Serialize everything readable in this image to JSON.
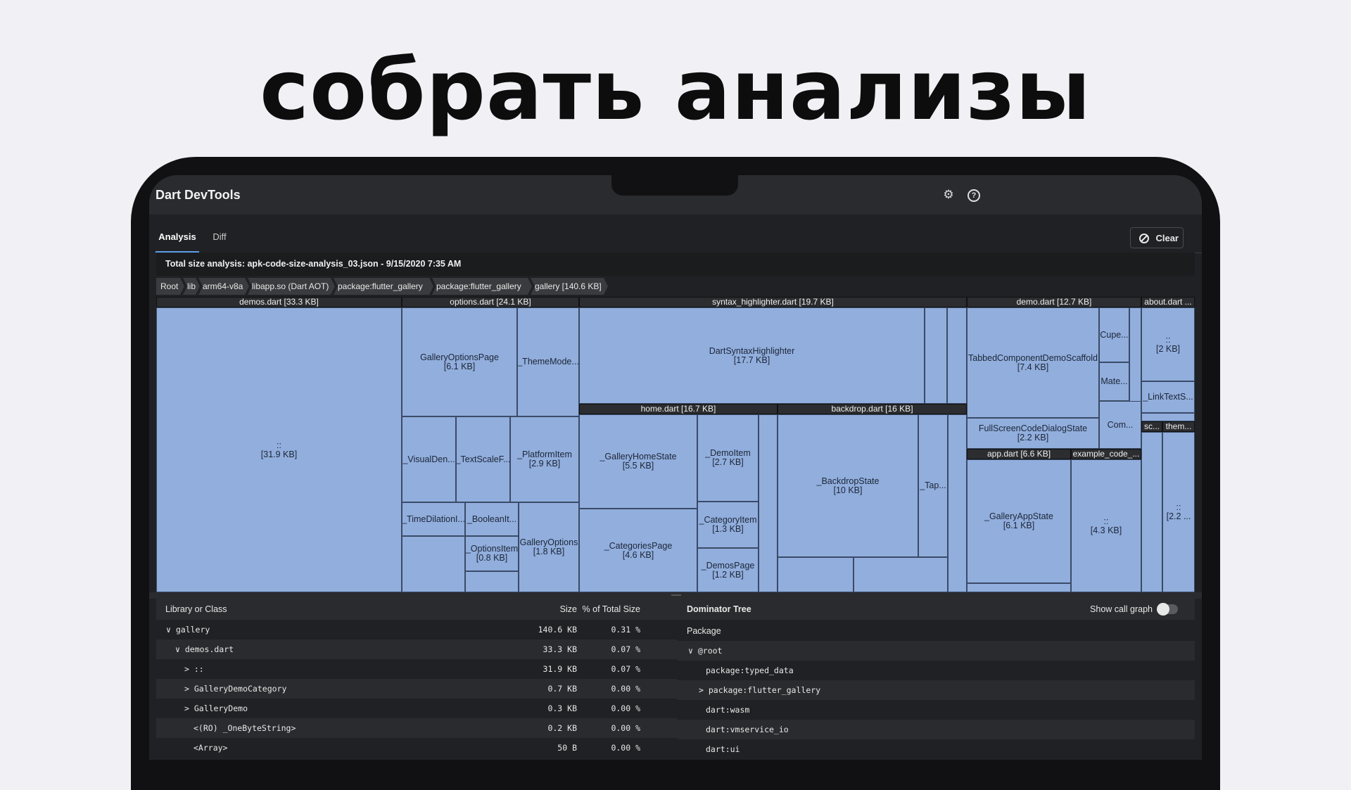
{
  "headline": "собрать анализы",
  "app": {
    "title": "Dart DevTools",
    "icons": [
      "settings-gear-icon",
      "help-circle-icon"
    ]
  },
  "tabs": [
    {
      "label": "Analysis",
      "active": true
    },
    {
      "label": "Diff",
      "active": false
    }
  ],
  "clear_label": "Clear",
  "summary": "Total size analysis: apk-code-size-analysis_03.json - 9/15/2020 7:35 AM",
  "breadcrumbs": [
    "Root",
    "lib",
    "arm64-v8a",
    "libapp.so (Dart AOT)",
    "package:flutter_gallery",
    "package:flutter_gallery",
    "gallery [140.6 KB]"
  ],
  "treemap": {
    "colors": {
      "cell": "#91aedd",
      "header": "#2c2d30"
    },
    "groups": {
      "demos": "demos.dart [33.3 KB]",
      "options": "options.dart [24.1 KB]",
      "syntax": "syntax_highlighter.dart [19.7 KB]",
      "demo": "demo.dart [12.7 KB]",
      "about": "about.dart ...",
      "home": "home.dart [16.7 KB]",
      "backdrop": "backdrop.dart [16 KB]",
      "app": "app.dart [6.6 KB]",
      "example": "example_code_...",
      "sc": "sc...",
      "them": "them..."
    },
    "cells": {
      "demos_root": "::\n[31.9 KB]",
      "gallery_options_page": "GalleryOptionsPage\n[6.1 KB]",
      "theme_mode": "_ThemeMode...",
      "visual_den": "_VisualDen...",
      "text_scale": "_TextScaleF...",
      "platform_item": "_PlatformItem\n[2.9 KB]",
      "time_dilation": "_TimeDilationI...",
      "boolean_it": "_BooleanIt...",
      "options_item": "_OptionsItem\n[0.8 KB]",
      "gallery_options": "GalleryOptions\n[1.8 KB]",
      "dart_syntax_highlighter": "DartSyntaxHighlighter\n[17.7 KB]",
      "gallery_home_state": "_GalleryHomeState\n[5.5 KB]",
      "demo_item": "_DemoItem\n[2.7 KB]",
      "categories_page": "_CategoriesPage\n[4.6 KB]",
      "category_item": "_CategoryItem\n[1.3 KB]",
      "demos_page": "_DemosPage\n[1.2 KB]",
      "backdrop_state": "_BackdropState\n[10 KB]",
      "tap": "_Tap...",
      "tabbed_component": "TabbedComponentDemoScaffold\n[7.4 KB]",
      "cupe": "Cupe...",
      "mate": "Mate...",
      "fullscreen_code": "FullScreenCodeDialogState\n[2.2 KB]",
      "com": "Com...",
      "about_root": "::\n[2 KB]",
      "link_text": "_LinkTextS...",
      "gallery_app_state": "_GalleryAppState\n[6.1 KB]",
      "example_root": "::\n[4.3 KB]",
      "them_root": "::\n[2.2 ..."
    }
  },
  "library_table": {
    "headers": {
      "name": "Library or Class",
      "size": "Size",
      "pct": "% of Total Size"
    },
    "rows": [
      {
        "name": "∨ gallery",
        "size": "140.6 KB",
        "pct": "0.31 %"
      },
      {
        "name": "∨ demos.dart",
        "size": "33.3 KB",
        "pct": "0.07 %"
      },
      {
        "name": "> ::",
        "size": "31.9 KB",
        "pct": "0.07 %"
      },
      {
        "name": "> GalleryDemoCategory",
        "size": "0.7 KB",
        "pct": "0.00 %"
      },
      {
        "name": "> GalleryDemo",
        "size": "0.3 KB",
        "pct": "0.00 %"
      },
      {
        "name": "<(RO) _OneByteString>",
        "size": "0.2 KB",
        "pct": "0.00 %"
      },
      {
        "name": "<Array>",
        "size": "50 B",
        "pct": "0.00 %"
      }
    ]
  },
  "dominator": {
    "title": "Dominator Tree",
    "call_graph_label": "Show call graph",
    "call_graph_on": false,
    "column": "Package",
    "rows": [
      "∨ @root",
      "package:typed_data",
      "> package:flutter_gallery",
      "dart:wasm",
      "dart:vmservice_io",
      "dart:ui"
    ]
  }
}
